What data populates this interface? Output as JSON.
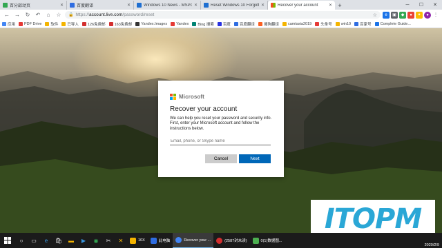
{
  "browser": {
    "tabs": [
      {
        "label": "百分啟动页",
        "color": "#34a853"
      },
      {
        "label": "百度翻译",
        "color": "#2f6de1"
      },
      {
        "label": "Windows 10 News - MSPowe",
        "color": "#1f6fd1"
      },
      {
        "label": "Reset Windows 10 Forgotten",
        "color": "#1f6fd1"
      },
      {
        "label": "Recover your account",
        "color": "#f25022"
      }
    ],
    "new_tab": "+",
    "url_scheme": "https://",
    "url_host": "account.live.com",
    "url_path": "/password/reset"
  },
  "bookmarks": [
    {
      "label": "应用",
      "color": "#4285f4"
    },
    {
      "label": "PDF Drive",
      "color": "#e53935"
    },
    {
      "label": "软件",
      "color": "#f4b400"
    },
    {
      "label": "已导入",
      "color": "#f4b400"
    },
    {
      "label": "126免费邮",
      "color": "#d32f2f"
    },
    {
      "label": "163免费邮",
      "color": "#d32f2f"
    },
    {
      "label": "Yandex.Images",
      "color": "#333333"
    },
    {
      "label": "Yandex",
      "color": "#e53935"
    },
    {
      "label": "Bing 搜索",
      "color": "#008373"
    },
    {
      "label": "百度",
      "color": "#2932e1"
    },
    {
      "label": "百度翻译",
      "color": "#2f6de1"
    },
    {
      "label": "搜狗翻译",
      "color": "#fb6022"
    },
    {
      "label": "camtasia2019",
      "color": "#f4b400"
    },
    {
      "label": "头条号",
      "color": "#e53935"
    },
    {
      "label": "win10",
      "color": "#f4b400"
    },
    {
      "label": "百家号",
      "color": "#2f6de1"
    },
    {
      "label": "Complete Guide...",
      "color": "#1a73e8"
    }
  ],
  "dialog": {
    "brand": "Microsoft",
    "logo_colors": [
      "#f25022",
      "#7fba00",
      "#00a4ef",
      "#ffb900"
    ],
    "title": "Recover your account",
    "description": "We can help you reset your password and security info. First, enter your Microsoft account and follow the instructions below.",
    "input_placeholder": "Email, phone, or Skype name",
    "cancel_label": "Cancel",
    "next_label": "Next"
  },
  "watermark": "ITOPM",
  "taskbar": {
    "apps": [
      {
        "label": "10X",
        "color": "#f4b400"
      },
      {
        "label": "此电脑",
        "color": "#2f6de1"
      },
      {
        "label": "Recover your ...",
        "color": "#4285f4"
      },
      {
        "label": "(2587封未读)",
        "color": "#d32f2f"
      },
      {
        "label": "0(1)数据图...",
        "color": "#4caf50"
      }
    ],
    "date": "2020/2/9"
  }
}
